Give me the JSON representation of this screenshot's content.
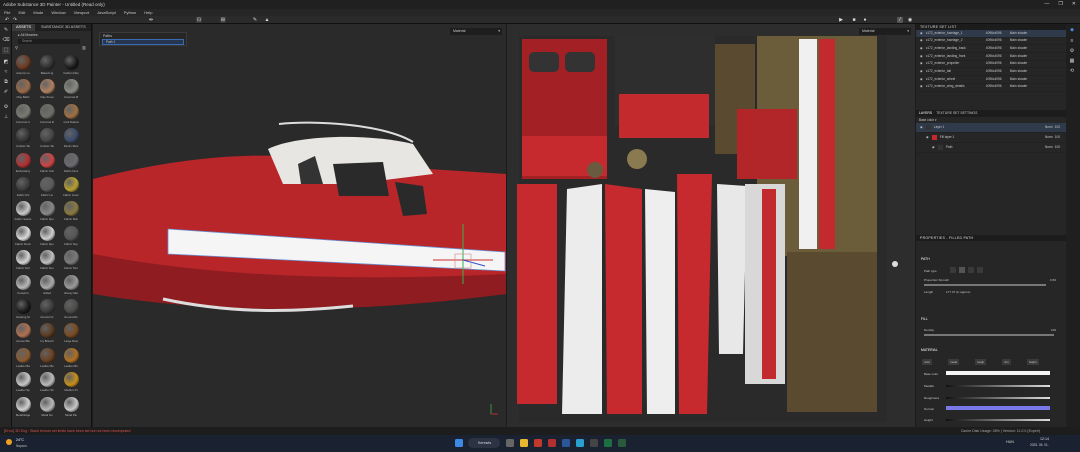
{
  "app": {
    "title": "Adobe Substance 3D Painter - Untitled (Read only)",
    "controls": [
      "—",
      "❐",
      "✕"
    ]
  },
  "menu": [
    "File",
    "Edit",
    "Mode",
    "Window",
    "Viewport",
    "JavaScript",
    "Python",
    "Help"
  ],
  "assets": {
    "tabs": [
      "ASSETS",
      "SUBSTANCE 3D ASSETS"
    ],
    "library": "All libraries",
    "search_placeholder": "Search",
    "items": [
      {
        "label": "Autumn Le",
        "color": "#6d3a20"
      },
      {
        "label": "Baked Lig",
        "color": "#2e2e2e"
      },
      {
        "label": "Carbon Fibe",
        "color": "#1a1a1a"
      },
      {
        "label": "Clay Bathr",
        "color": "#9a6a48"
      },
      {
        "label": "Clay Smoo",
        "color": "#b08060"
      },
      {
        "label": "Concrete B",
        "color": "#8a8a84"
      },
      {
        "label": "Concrete C",
        "color": "#7a7a72"
      },
      {
        "label": "Concrete D",
        "color": "#6e6e68"
      },
      {
        "label": "Cork Natura",
        "color": "#a07040"
      },
      {
        "label": "Custom Sk",
        "color": "#333"
      },
      {
        "label": "Custom Sk",
        "color": "#444"
      },
      {
        "label": "Denim Ruis",
        "color": "#3a4a6a"
      },
      {
        "label": "Embroidery",
        "color": "#b03030"
      },
      {
        "label": "Fabric Cott",
        "color": "#cc4444"
      },
      {
        "label": "Fabric Deni",
        "color": "#6a6a70"
      },
      {
        "label": "Fabric Kni",
        "color": "#3a3a3a"
      },
      {
        "label": "Fabric Lin",
        "color": "#5a5a58"
      },
      {
        "label": "Fabric Linen",
        "color": "#b8a030"
      },
      {
        "label": "Fabric Suedo",
        "color": "#c8c8c8"
      },
      {
        "label": "Fabric Spu",
        "color": "#888"
      },
      {
        "label": "Fabric Rub",
        "color": "#8a7a40"
      },
      {
        "label": "Fabric Sonic",
        "color": "#dadada"
      },
      {
        "label": "Fabric Spo",
        "color": "#cfcfcf"
      },
      {
        "label": "Fabric Sup",
        "color": "#555"
      },
      {
        "label": "Fabric Soft",
        "color": "#d5d5d5"
      },
      {
        "label": "Fabric Sun",
        "color": "#c0c0c0"
      },
      {
        "label": "Fabric Tent",
        "color": "#7a7a7a"
      },
      {
        "label": "Footprint",
        "color": "#b8b8b8"
      },
      {
        "label": "Gilded",
        "color": "#aaa"
      },
      {
        "label": "Glossy Met",
        "color": "#9a9a9a"
      },
      {
        "label": "Glowing Gl",
        "color": "#1a1a1a"
      },
      {
        "label": "Ground Gr",
        "color": "#3a3a3a"
      },
      {
        "label": "Ground Ro",
        "color": "#4a4a48"
      },
      {
        "label": "Human Ba",
        "color": "#b07050"
      },
      {
        "label": "Ivy Branch",
        "color": "#5a3a20"
      },
      {
        "label": "Large Rust",
        "color": "#7a4a20"
      },
      {
        "label": "Leather Ba",
        "color": "#8a5a30"
      },
      {
        "label": "Leather Bu",
        "color": "#6a4020"
      },
      {
        "label": "Leather Bri",
        "color": "#b07020"
      },
      {
        "label": "Leather Sp",
        "color": "#c8c8c8"
      },
      {
        "label": "Leather Sh",
        "color": "#bbb"
      },
      {
        "label": "Medium Pi",
        "color": "#c8901a"
      },
      {
        "label": "Metal Edge",
        "color": "#d0d0d0"
      },
      {
        "label": "Metal Gu",
        "color": "#b8b8b8"
      },
      {
        "label": "Metal Pai",
        "color": "#c8c8c8"
      }
    ]
  },
  "viewport3d": {
    "mode": "Material",
    "layer_panel": {
      "title": "Paths",
      "item": "Path 1"
    }
  },
  "viewport2d": {
    "mode": "Material"
  },
  "texture_set_list": {
    "title": "TEXTURE SET LIST",
    "rows": [
      {
        "name": "c172_exterior_fuselage_1",
        "size": "4096x4096",
        "shader": "Main shader"
      },
      {
        "name": "c172_exterior_fuselage_2",
        "size": "4096x4096",
        "shader": "Main shader"
      },
      {
        "name": "c172_exterior_landing_back",
        "size": "4096x4096",
        "shader": "Main shader"
      },
      {
        "name": "c172_exterior_landing_front",
        "size": "4096x4096",
        "shader": "Main shader"
      },
      {
        "name": "c172_exterior_propeller",
        "size": "4096x4096",
        "shader": "Main shader"
      },
      {
        "name": "c172_exterior_tail",
        "size": "4096x4096",
        "shader": "Main shader"
      },
      {
        "name": "c172_exterior_wheel",
        "size": "4096x4096",
        "shader": "Main shader"
      },
      {
        "name": "c172_exterior_wing_details",
        "size": "4096x4096",
        "shader": "Main shader"
      }
    ]
  },
  "layers": {
    "tabs": [
      "LAYERS",
      "TEXTURE SET SETTINGS"
    ],
    "channel": "Base color",
    "items": [
      {
        "name": "Layer 1",
        "blend": "Norm",
        "opacity": "100"
      },
      {
        "name": "Fill layer 1",
        "blend": "Norm",
        "opacity": "100"
      },
      {
        "name": "Path",
        "blend": "Norm",
        "opacity": "100"
      }
    ]
  },
  "properties": {
    "title": "PROPERTIES - FILLED PATH",
    "path_label": "PATH",
    "path_type_label": "Path type",
    "proportion_label": "Proportion Smooth",
    "proportion_value": "0.50",
    "length_label": "Length",
    "length_value": "177.37 (in approx)",
    "fill_label": "FILL",
    "density_label": "Density",
    "density_value": "100",
    "material_label": "MATERIAL",
    "channel_buttons": [
      "color",
      "metal",
      "rough",
      "nrm",
      "height"
    ],
    "channels": [
      {
        "label": "Base color",
        "value": ""
      },
      {
        "label": "Metallic",
        "value": "0"
      },
      {
        "label": "Roughness",
        "value": "0.3"
      },
      {
        "label": "Normal",
        "value": ""
      },
      {
        "label": "Height",
        "value": "0"
      }
    ]
  },
  "status": {
    "left": "[Error] 3D Eng : Stack texture set limits have been set but not been recomputed",
    "right": "Cache Disk Usage: 28% | Version: 11.0.0 (Experi)"
  },
  "taskbar": {
    "weather_temp": "24°C",
    "weather_desc": "Napsos",
    "search": "Keresés",
    "lang": "HUN",
    "time": "12:14",
    "date": "2025. 05. 01."
  },
  "colors": {
    "accent": "#1e6fd1",
    "red": "#c22a2e",
    "white": "#f2f2f2"
  }
}
